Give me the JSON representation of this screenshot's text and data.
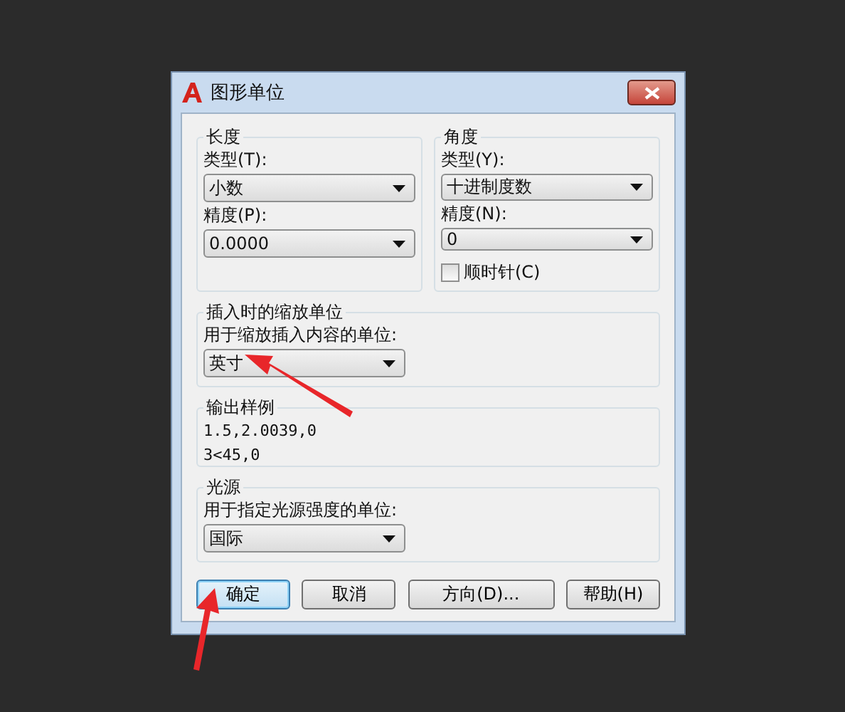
{
  "window": {
    "title": "图形单位"
  },
  "length": {
    "title": "长度",
    "type_label": "类型(T):",
    "type_value": "小数",
    "precision_label": "精度(P):",
    "precision_value": "0.0000"
  },
  "angle": {
    "title": "角度",
    "type_label": "类型(Y):",
    "type_value": "十进制度数",
    "precision_label": "精度(N):",
    "precision_value": "0",
    "clockwise": {
      "label": "顺时针(C)",
      "checked": false
    }
  },
  "insertion": {
    "title": "插入时的缩放单位",
    "label": "用于缩放插入内容的单位:",
    "value": "英寸"
  },
  "sample": {
    "title": "输出样例",
    "lines": [
      "1.5,2.0039,0",
      "3<45,0"
    ]
  },
  "lighting": {
    "title": "光源",
    "label": "用于指定光源强度的单位:",
    "value": "国际"
  },
  "buttons": [
    {
      "label": "确定",
      "default": true
    },
    {
      "label": "取消",
      "default": false
    },
    {
      "label": "方向(D)...",
      "default": false
    },
    {
      "label": "帮助(H)",
      "default": false
    }
  ]
}
